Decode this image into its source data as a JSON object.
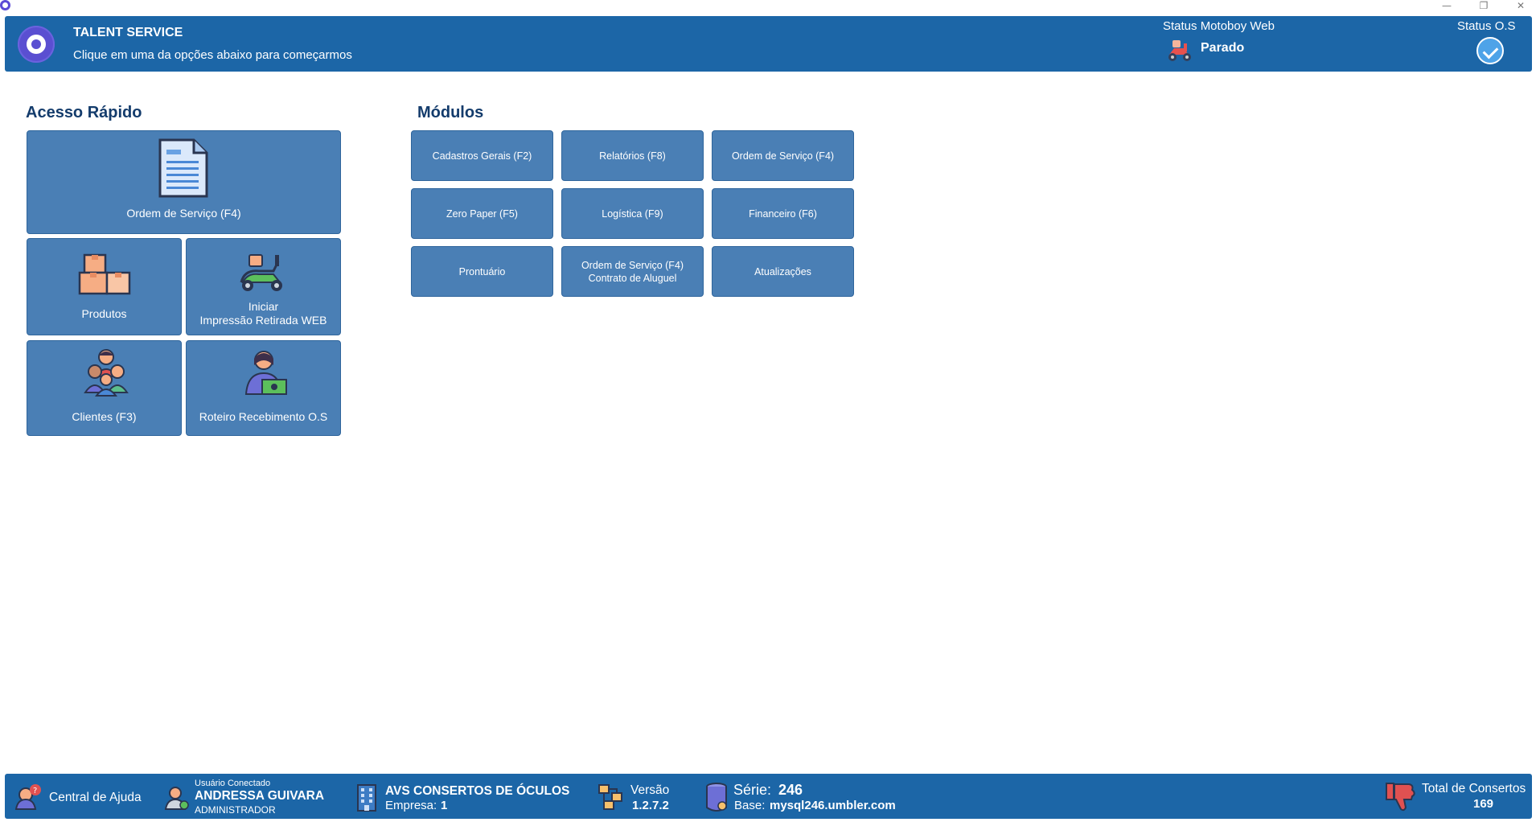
{
  "header": {
    "title": "TALENT SERVICE",
    "subtitle": "Clique em uma da opções abaixo para começarmos",
    "motoboy_label": "Status Motoboy Web",
    "motoboy_status": "Parado",
    "os_label": "Status O.S"
  },
  "quick_access": {
    "title": "Acesso Rápido",
    "ordem_servico": "Ordem de Serviço (F4)",
    "produtos": "Produtos",
    "iniciar_line1": "Iniciar",
    "iniciar_line2": "Impressão Retirada WEB",
    "clientes": "Clientes (F3)",
    "roteiro": "Roteiro Recebimento O.S"
  },
  "modules": {
    "title": "Módulos",
    "items": [
      "Cadastros Gerais (F2)",
      "Relatórios (F8)",
      "Ordem de Serviço (F4)",
      "Zero Paper (F5)",
      "Logística (F9)",
      "Financeiro (F6)",
      "Prontuário",
      "Ordem de Serviço (F4)\nContrato de Aluguel",
      "Atualizações"
    ]
  },
  "footer": {
    "help": "Central de Ajuda",
    "user_caption": "Usuário Conectado",
    "user_name": "ANDRESSA GUIVARA",
    "user_role": "ADMINISTRADOR",
    "company_name": "AVS CONSERTOS DE ÓCULOS",
    "company_label": "Empresa:",
    "company_value": "1",
    "version_label": "Versão",
    "version_value": "1.2.7.2",
    "serie_label": "Série:",
    "serie_value": "246",
    "base_label": "Base:",
    "base_value": "mysql246.umbler.com",
    "total_label": "Total de Consertos",
    "total_value": "169"
  },
  "window_controls": {
    "minimize": "—",
    "restore": "❐",
    "close": "✕"
  },
  "colors": {
    "header": "#1c66a7",
    "tile": "#4a7fb5",
    "title": "#143c6c"
  },
  "icons": [
    "app-logo-icon",
    "motoboy-scooter-icon",
    "status-check-icon",
    "document-icon",
    "boxes-icon",
    "scooter-icon",
    "clients-group-icon",
    "person-money-icon",
    "help-icon",
    "user-icon",
    "building-icon",
    "version-icon",
    "database-icon",
    "thumbs-down-icon"
  ]
}
